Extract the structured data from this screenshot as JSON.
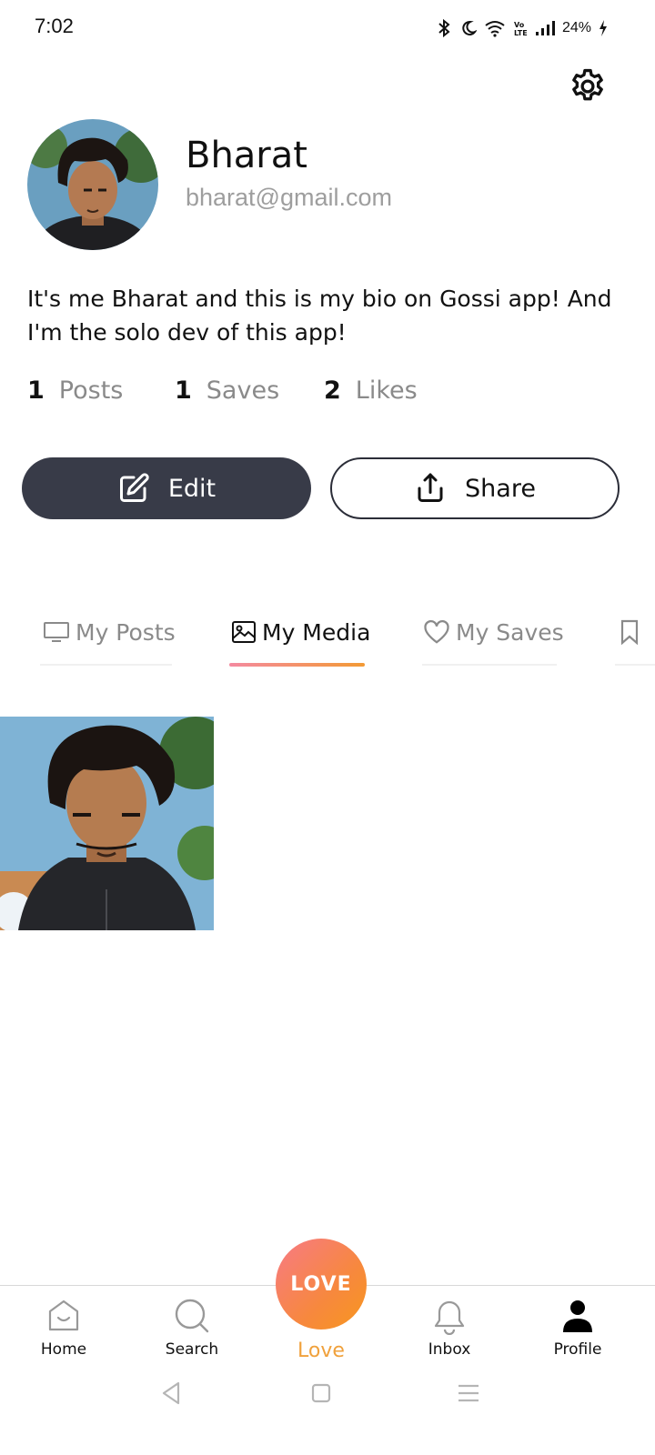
{
  "status": {
    "time": "7:02",
    "battery": "24%"
  },
  "profile": {
    "name": "Bharat",
    "email": "bharat@gmail.com",
    "bio": "It's me Bharat and this is my bio on Gossi app! And I'm the solo dev of this app!"
  },
  "stats": [
    {
      "count": "1",
      "label": "Posts"
    },
    {
      "count": "1",
      "label": "Saves"
    },
    {
      "count": "2",
      "label": "Likes"
    }
  ],
  "actions": {
    "edit_label": "Edit",
    "share_label": "Share"
  },
  "tabs": [
    {
      "label": "My Posts",
      "icon": "monitor-icon",
      "active": false
    },
    {
      "label": "My Media",
      "icon": "image-icon",
      "active": true
    },
    {
      "label": "My Saves",
      "icon": "heart-icon",
      "active": false
    },
    {
      "label": "",
      "icon": "bookmark-icon",
      "active": false
    }
  ],
  "bottom_nav": {
    "items": [
      {
        "label": "Home",
        "icon": "home-icon"
      },
      {
        "label": "Search",
        "icon": "search-icon"
      },
      {
        "label": "Love",
        "icon": "love-button",
        "badge_text": "LOVE"
      },
      {
        "label": "Inbox",
        "icon": "bell-icon"
      },
      {
        "label": "Profile",
        "icon": "person-icon",
        "active": true
      }
    ]
  },
  "colors": {
    "primary_dark": "#383b48",
    "accent_gradient_start": "#f77a86",
    "accent_gradient_end": "#f7971e",
    "love_label": "#f0a13c",
    "muted_text": "#8a8a8a"
  }
}
